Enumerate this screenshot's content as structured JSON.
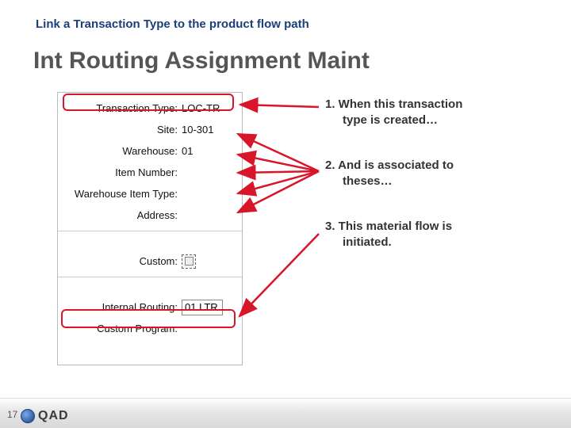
{
  "header": {
    "subtitle": "Link a Transaction Type to the product flow path",
    "title": "Int Routing Assignment Maint"
  },
  "panel": {
    "transaction_type": {
      "label": "Transaction Type:",
      "value": "LOC-TR"
    },
    "site": {
      "label": "Site:",
      "value": "10-301"
    },
    "warehouse": {
      "label": "Warehouse:",
      "value": "01"
    },
    "item_number": {
      "label": "Item Number:",
      "value": ""
    },
    "warehouse_item_type": {
      "label": "Warehouse Item Type:",
      "value": ""
    },
    "address": {
      "label": "Address:",
      "value": ""
    },
    "custom": {
      "label": "Custom:"
    },
    "internal_routing": {
      "label": "Internal Routing:",
      "value": "01 LTR"
    },
    "custom_program": {
      "label": "Custom Program:",
      "value": ""
    }
  },
  "notes": {
    "n1a": "1.  When this transaction",
    "n1b": "type is created…",
    "n2a": "2.  And is associated to",
    "n2b": "theses…",
    "n3a": "3.  This material flow is",
    "n3b": "initiated."
  },
  "footer": {
    "page": "17",
    "brand": "QAD"
  }
}
